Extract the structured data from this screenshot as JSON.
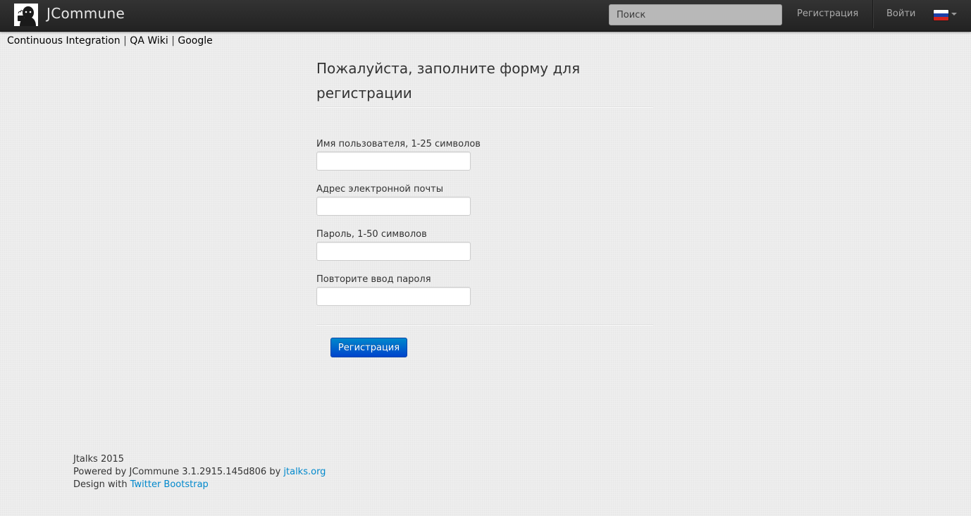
{
  "navbar": {
    "brand": "JCommune",
    "search_placeholder": "Поиск",
    "register_label": "Регистрация",
    "login_label": "Войти",
    "language_icon": "russian-flag-icon"
  },
  "toplinks": {
    "items": [
      "Continuous Integration",
      "QA Wiki",
      "Google"
    ],
    "separator": "|"
  },
  "form": {
    "title": "Пожалуйста, заполните форму для регистрации",
    "fields": [
      {
        "label": "Имя пользователя, 1-25 символов",
        "value": ""
      },
      {
        "label": "Адрес электронной почты",
        "value": ""
      },
      {
        "label": "Пароль, 1-50 символов",
        "value": ""
      },
      {
        "label": "Повторите ввод пароля",
        "value": ""
      }
    ],
    "submit_label": "Регистрация"
  },
  "footer": {
    "copyright": "Jtalks 2015",
    "powered_prefix": "Powered by JCommune 3.1.2915.145d806 by ",
    "powered_link": "jtalks.org",
    "design_prefix": "Design with ",
    "design_link": "Twitter Bootstrap"
  },
  "colors": {
    "navbar_bg": "#222222",
    "button_primary": "#0055cc",
    "link": "#0088cc"
  }
}
